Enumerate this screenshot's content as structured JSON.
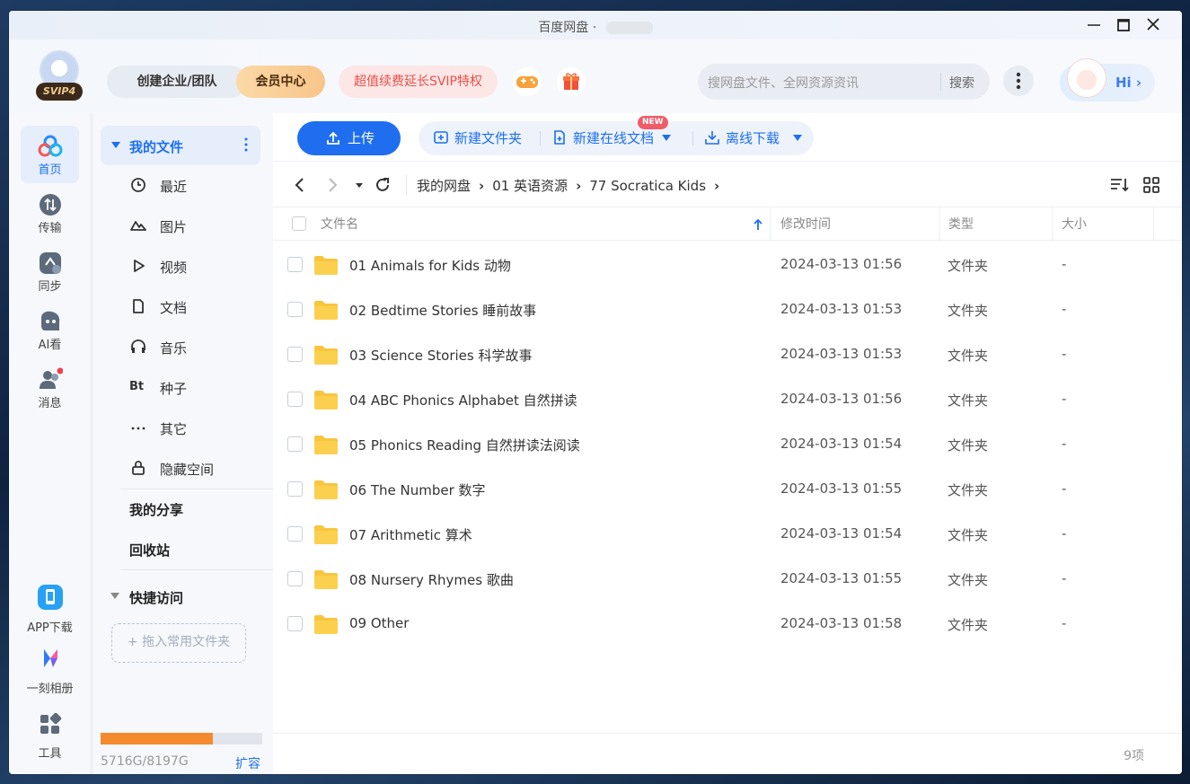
{
  "window": {
    "title": "百度网盘",
    "title_sep": "·"
  },
  "header": {
    "svip_badge": "SVIP4",
    "team_button": "创建企业/团队",
    "vip_button": "会员中心",
    "promo_button": "超值续费延长SVIP特权",
    "search": {
      "placeholder": "搜网盘文件、全网资源资讯",
      "button": "搜索"
    },
    "hi_label": "Hi ›"
  },
  "rail": {
    "top_items": [
      {
        "label": "首页",
        "icon": "home-cloud-icon"
      },
      {
        "label": "传输",
        "icon": "transfer-icon"
      },
      {
        "label": "同步",
        "icon": "sync-icon"
      },
      {
        "label": "AI看",
        "icon": "ai-view-icon"
      },
      {
        "label": "消息",
        "icon": "message-icon"
      }
    ],
    "bottom_items": [
      {
        "label": "APP下载",
        "icon": "app-download-icon"
      },
      {
        "label": "一刻相册",
        "icon": "album-icon"
      },
      {
        "label": "工具",
        "icon": "tools-icon"
      }
    ]
  },
  "sidebar": {
    "my_files": "我的文件",
    "items": [
      {
        "label": "最近",
        "icon": "clock-icon"
      },
      {
        "label": "图片",
        "icon": "image-icon"
      },
      {
        "label": "视频",
        "icon": "play-icon"
      },
      {
        "label": "文档",
        "icon": "document-icon"
      },
      {
        "label": "音乐",
        "icon": "headphones-icon"
      },
      {
        "label": "种子",
        "icon": "bt-icon",
        "glyph": "Bt"
      },
      {
        "label": "其它",
        "icon": "more-icon"
      },
      {
        "label": "隐藏空间",
        "icon": "lock-icon"
      }
    ],
    "my_share": "我的分享",
    "recycle": "回收站",
    "quick_access": "快捷访问",
    "dropzone": "+ 拖入常用文件夹",
    "storage": {
      "text": "5716G/8197G",
      "used_fraction": 0.697,
      "expand": "扩容"
    }
  },
  "toolbar": {
    "upload": "上传",
    "new_folder": "新建文件夹",
    "new_doc": "新建在线文档",
    "new_badge": "NEW",
    "offline": "离线下载"
  },
  "breadcrumb": [
    "我的网盘",
    "01 英语资源",
    "77 Socratica Kids"
  ],
  "table": {
    "headers": {
      "name": "文件名",
      "date": "修改时间",
      "type": "类型",
      "size": "大小"
    },
    "rows": [
      {
        "name": "01 Animals for Kids 动物",
        "date": "2024-03-13 01:56",
        "type": "文件夹",
        "size": "-"
      },
      {
        "name": "02 Bedtime Stories 睡前故事",
        "date": "2024-03-13 01:53",
        "type": "文件夹",
        "size": "-"
      },
      {
        "name": "03 Science Stories 科学故事",
        "date": "2024-03-13 01:53",
        "type": "文件夹",
        "size": "-"
      },
      {
        "name": "04 ABC Phonics Alphabet 自然拼读",
        "date": "2024-03-13 01:56",
        "type": "文件夹",
        "size": "-"
      },
      {
        "name": "05 Phonics Reading 自然拼读法阅读",
        "date": "2024-03-13 01:54",
        "type": "文件夹",
        "size": "-"
      },
      {
        "name": "06 The Number 数字",
        "date": "2024-03-13 01:55",
        "type": "文件夹",
        "size": "-"
      },
      {
        "name": "07 Arithmetic 算术",
        "date": "2024-03-13 01:54",
        "type": "文件夹",
        "size": "-"
      },
      {
        "name": "08 Nursery Rhymes 歌曲",
        "date": "2024-03-13 01:55",
        "type": "文件夹",
        "size": "-"
      },
      {
        "name": "09 Other",
        "date": "2024-03-13 01:58",
        "type": "文件夹",
        "size": "-"
      }
    ]
  },
  "footer": {
    "count": "9项"
  },
  "colors": {
    "accent": "#1f6ef0",
    "storage_fill": "#f48a2e",
    "badge_red": "#f05b6a",
    "folder": "#f9c53e"
  }
}
